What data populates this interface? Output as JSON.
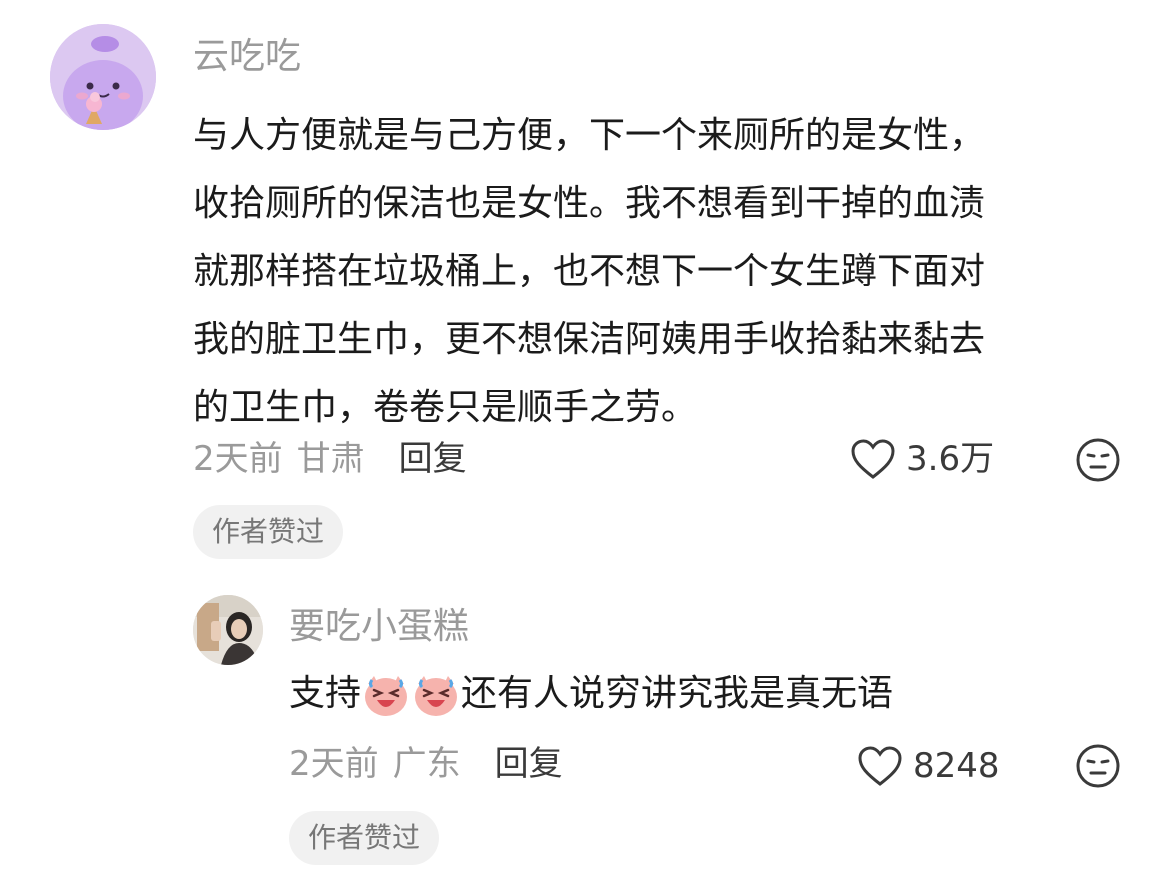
{
  "comments": [
    {
      "username": "云吃吃",
      "lines": [
        "与人方便就是与己方便，下一个来厕所的是女性，",
        "收拾厕所的保洁也是女性。我不想看到干掉的血渍",
        "就那样搭在垃圾桶上，也不想下一个女生蹲下面对",
        "我的脏卫生巾，更不想保洁阿姨用手收拾黏来黏去",
        "的卫生巾，卷卷只是顺手之劳。"
      ],
      "time": "2天前",
      "location": "甘肃",
      "reply_label": "回复",
      "likes": "3.6万",
      "badge": "作者赞过",
      "avatar_icon": "cartoon-purple-avatar-icon"
    },
    {
      "username": "要吃小蛋糕",
      "text_prefix": "支持",
      "emojis": [
        "crying-laughing-emoji",
        "crying-laughing-emoji"
      ],
      "text_suffix": "还有人说穷讲究我是真无语",
      "time": "2天前",
      "location": "广东",
      "reply_label": "回复",
      "likes": "8248",
      "badge": "作者赞过",
      "avatar_icon": "photo-avatar-icon"
    }
  ],
  "colors": {
    "meta_gray": "#9a9a9a",
    "text_dark": "#1b1b1b",
    "badge_bg": "#f1f1f1",
    "avatar_purple": "#d9c4ef"
  }
}
